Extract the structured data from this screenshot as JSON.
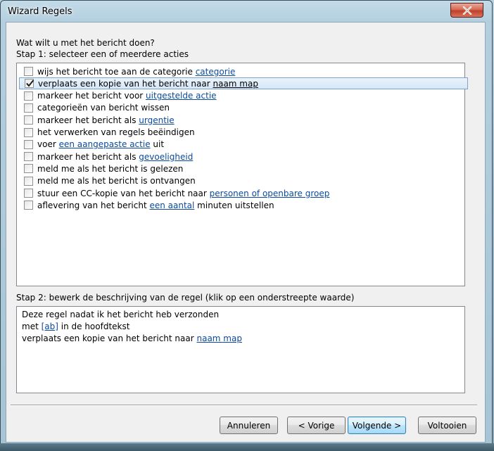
{
  "window": {
    "title": "Wizard Regels",
    "close_label": "×"
  },
  "question": "Wat wilt u met het bericht doen?",
  "step1_label": "Stap 1: selecteer een of meerdere acties",
  "actions": [
    {
      "checked": false,
      "selected": false,
      "parts": [
        {
          "text": "wijs het bericht toe aan de categorie "
        },
        {
          "text": "categorie",
          "link": true
        }
      ]
    },
    {
      "checked": true,
      "selected": true,
      "parts": [
        {
          "text": "verplaats een kopie van het bericht naar "
        },
        {
          "text": "naam map",
          "link": true,
          "dark": true
        }
      ]
    },
    {
      "checked": false,
      "selected": false,
      "parts": [
        {
          "text": "markeer het bericht voor "
        },
        {
          "text": "uitgestelde actie",
          "link": true
        }
      ]
    },
    {
      "checked": false,
      "selected": false,
      "parts": [
        {
          "text": "categorieën van bericht wissen"
        }
      ]
    },
    {
      "checked": false,
      "selected": false,
      "parts": [
        {
          "text": "markeer het bericht als "
        },
        {
          "text": "urgentie",
          "link": true
        }
      ]
    },
    {
      "checked": false,
      "selected": false,
      "parts": [
        {
          "text": "het verwerken van regels beëindigen"
        }
      ]
    },
    {
      "checked": false,
      "selected": false,
      "parts": [
        {
          "text": "voer "
        },
        {
          "text": "een aangepaste actie",
          "link": true
        },
        {
          "text": " uit"
        }
      ]
    },
    {
      "checked": false,
      "selected": false,
      "parts": [
        {
          "text": "markeer het bericht als "
        },
        {
          "text": "gevoeligheid",
          "link": true
        }
      ]
    },
    {
      "checked": false,
      "selected": false,
      "parts": [
        {
          "text": "meld me als het bericht is gelezen"
        }
      ]
    },
    {
      "checked": false,
      "selected": false,
      "parts": [
        {
          "text": "meld me als het bericht is ontvangen"
        }
      ]
    },
    {
      "checked": false,
      "selected": false,
      "parts": [
        {
          "text": "stuur een CC-kopie van het bericht naar "
        },
        {
          "text": "personen of openbare groep",
          "link": true
        }
      ]
    },
    {
      "checked": false,
      "selected": false,
      "parts": [
        {
          "text": "aflevering van het bericht "
        },
        {
          "text": "een aantal",
          "link": true
        },
        {
          "text": " minuten uitstellen"
        }
      ]
    }
  ],
  "step2_label": "Stap 2: bewerk de beschrijving van de regel (klik op een onderstreepte waarde)",
  "description": [
    [
      {
        "text": "Deze regel nadat ik het bericht heb verzonden"
      }
    ],
    [
      {
        "text": "met "
      },
      {
        "text": "[ab]",
        "link": true
      },
      {
        "text": " in de hoofdtekst"
      }
    ],
    [
      {
        "text": "verplaats een kopie van het bericht naar "
      },
      {
        "text": "naam map",
        "link": true
      }
    ]
  ],
  "buttons": {
    "cancel": "Annuleren",
    "back": "< Vorige",
    "next": "Volgende >",
    "finish": "Voltooien"
  },
  "colors": {
    "link": "#0a4a9c",
    "selection_border": "#7da2ce",
    "close_button": "#c0402a"
  }
}
